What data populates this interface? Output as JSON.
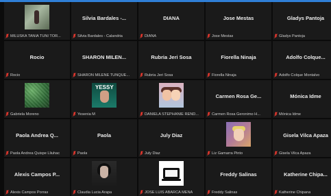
{
  "theme": {
    "accent_bar": "#2f7fd6",
    "tile_background": "#1a1a1a",
    "page_background": "#0b0b0b",
    "mic_muted_color": "#ff3b30"
  },
  "tiles": [
    {
      "display_name": "",
      "label": "MILUSKA TANIA TUNI TOR..."
    },
    {
      "display_name": "Silvia Bardales -...",
      "label": "Silvia Bardales - Calandria"
    },
    {
      "display_name": "DIANA",
      "label": "DIANA"
    },
    {
      "display_name": "Jose Mestas",
      "label": "Jose Mestas"
    },
    {
      "display_name": "Gladys Pantoja",
      "label": "Gladys Pantoja"
    },
    {
      "display_name": "Rocio",
      "label": "Rocio"
    },
    {
      "display_name": "SHARON MILEN...",
      "label": "SHARON MILENE TUNQUE..."
    },
    {
      "display_name": "Rubria Jeri Sosa",
      "label": "Rubria Jeri Sosa"
    },
    {
      "display_name": "Fiorella Ninaja",
      "label": "Fiorella Ninaja"
    },
    {
      "display_name": "Adolfo Colque...",
      "label": "Adolfo Colque Montalvo"
    },
    {
      "display_name": "",
      "label": "Gabriela Moreno"
    },
    {
      "display_name": "",
      "label": "Yesenia M"
    },
    {
      "display_name": "",
      "label": "DANIELA STEPHANIE REND..."
    },
    {
      "display_name": "Carmen Rosa Ge...",
      "label": "Carmen Rosa Geronimo H..."
    },
    {
      "display_name": "Mónica Idme",
      "label": "Mónica Idme"
    },
    {
      "display_name": "Paola Andrea Q...",
      "label": "Paola Andrea Quispe Lliuhac"
    },
    {
      "display_name": "Paola",
      "label": "Paola"
    },
    {
      "display_name": "July Diaz",
      "label": "July Diaz"
    },
    {
      "display_name": "",
      "label": "Liz Gamarra Pinto"
    },
    {
      "display_name": "Gisela Vilca Apaza",
      "label": "Gisela Vilca Apaza"
    },
    {
      "display_name": "Alexis Campos P...",
      "label": "Alexis Campos Porras"
    },
    {
      "display_name": "",
      "label": "Claudia Lucia Arapa"
    },
    {
      "display_name": "",
      "label": "JOSE LUIS ABARCA MENA"
    },
    {
      "display_name": "Freddy Salinas",
      "label": "Freddy Salinas"
    },
    {
      "display_name": "Katherine Chipa...",
      "label": "Katherine Chipana"
    }
  ],
  "thumb_text": {
    "yesenia_word": "YESSY"
  }
}
